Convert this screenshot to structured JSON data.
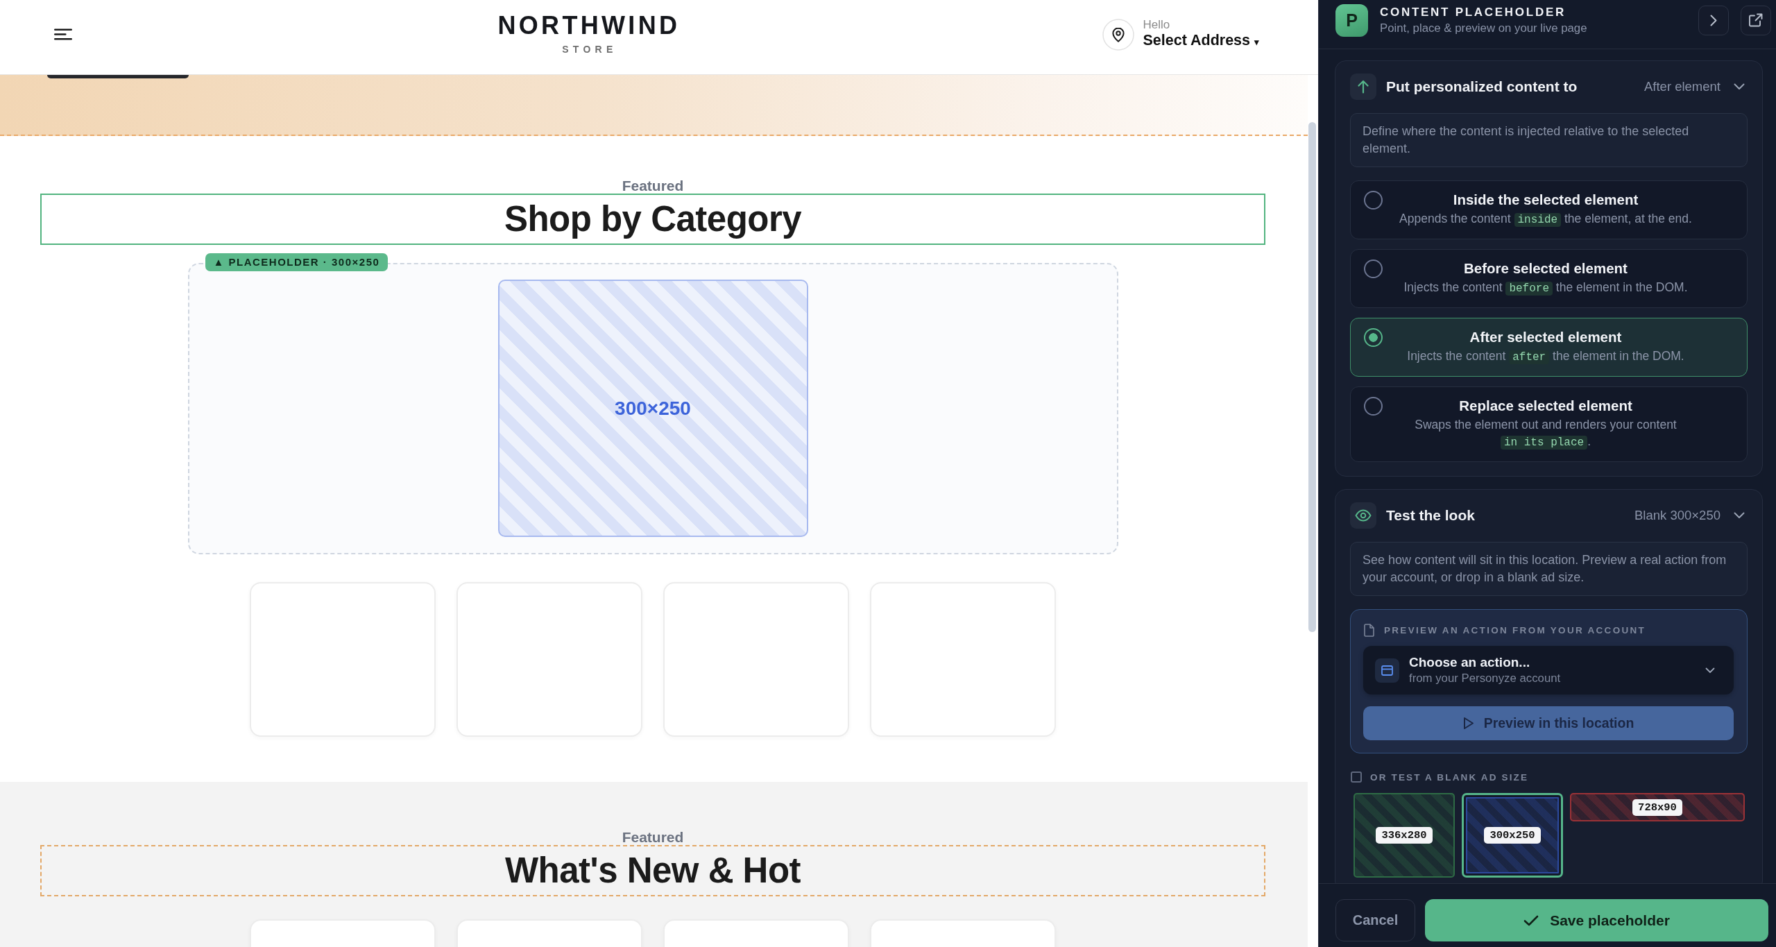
{
  "storefront": {
    "header": {
      "brand": "NORTHWIND",
      "tagline": "STORE",
      "greeting": "Hello",
      "address": "Select Address",
      "address_caret": "▾"
    },
    "hero": {
      "highlighted": true
    },
    "sections": [
      {
        "eyebrow": "Featured",
        "title": "Shop by Category",
        "selected": true,
        "highlighted": false,
        "placeholder": {
          "badge": "▲ PLACEHOLDER · 300×250",
          "slot_label": "300×250"
        }
      },
      {
        "eyebrow": "Featured",
        "title": "What's New & Hot",
        "selected": false,
        "highlighted": true
      }
    ]
  },
  "panel": {
    "logo": "P",
    "title": "CONTENT PLACEHOLDER",
    "subtitle": "Point, place & preview on your live page",
    "sections": [
      {
        "kind": "position",
        "title": "Put personalized content to",
        "value": "After element",
        "description": "Define where the content is injected relative to the selected element.",
        "options": [
          {
            "title": "Inside the selected element",
            "selected": false,
            "description": [
              {
                "kind": "plain",
                "text": "Appends the content "
              },
              {
                "kind": "code",
                "text": "inside"
              },
              {
                "kind": "plain",
                "text": " the element, at the end."
              }
            ]
          },
          {
            "title": "Before selected element",
            "selected": false,
            "description": [
              {
                "kind": "plain",
                "text": "Injects the content "
              },
              {
                "kind": "code",
                "text": "before"
              },
              {
                "kind": "plain",
                "text": " the element in the DOM."
              }
            ]
          },
          {
            "title": "After selected element",
            "selected": true,
            "description": [
              {
                "kind": "plain",
                "text": "Injects the content "
              },
              {
                "kind": "code",
                "text": "after"
              },
              {
                "kind": "plain",
                "text": " the element in the DOM."
              }
            ]
          },
          {
            "title": "Replace selected element",
            "selected": false,
            "description": [
              {
                "kind": "plain",
                "text": "Swaps the element out and renders your content "
              },
              {
                "kind": "code",
                "text": "in its place"
              },
              {
                "kind": "plain",
                "text": "."
              }
            ]
          }
        ]
      },
      {
        "kind": "preview",
        "title": "Test the look",
        "value": "Blank 300×250",
        "description": "See how content will sit in this location. Preview a real action from your account, or drop in a blank ad size.",
        "action": {
          "label": "PREVIEW AN ACTION FROM YOUR ACCOUNT",
          "prompt": "Choose an action...",
          "hint": "from your Personyze account",
          "button": "Preview in this location",
          "disabled": true
        },
        "blank_sizes": {
          "label": "OR TEST A BLANK AD SIZE",
          "checked": false,
          "options": [
            {
              "label": "336x280",
              "kind": "rectangle",
              "color": "#2e6b45",
              "selected": false
            },
            {
              "label": "300x250",
              "kind": "rectangle",
              "color": "#2d4a9e",
              "selected": true
            },
            {
              "label": "728x90",
              "kind": "banner",
              "color": "#9a3237",
              "selected": false
            }
          ]
        }
      }
    ],
    "footer": {
      "cancel": "Cancel",
      "save": "Save placeholder"
    }
  }
}
